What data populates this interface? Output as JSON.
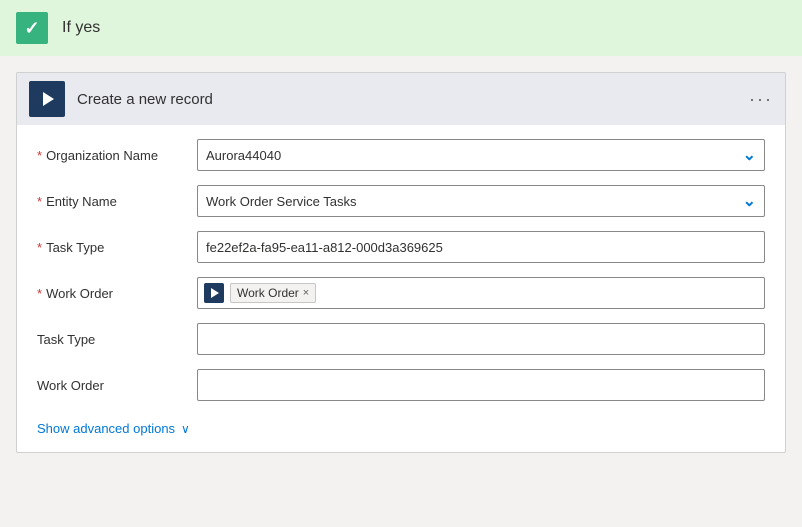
{
  "header": {
    "title": "If yes",
    "check_label": "✓"
  },
  "card": {
    "title": "Create a new record",
    "menu_dots": "···"
  },
  "form": {
    "fields": [
      {
        "label": "Organization Name",
        "required": true,
        "type": "dropdown",
        "value": "Aurora44040"
      },
      {
        "label": "Entity Name",
        "required": true,
        "type": "dropdown",
        "value": "Work Order Service Tasks"
      },
      {
        "label": "Task Type",
        "required": true,
        "type": "text",
        "value": "fe22ef2a-fa95-ea11-a812-000d3a369625"
      },
      {
        "label": "Work Order",
        "required": true,
        "type": "tag",
        "tag_value": "Work Order"
      },
      {
        "label": "Task Type",
        "required": false,
        "type": "empty",
        "value": ""
      },
      {
        "label": "Work Order",
        "required": false,
        "type": "empty",
        "value": ""
      }
    ]
  },
  "advanced": {
    "label": "Show advanced options",
    "chevron": "∨"
  }
}
